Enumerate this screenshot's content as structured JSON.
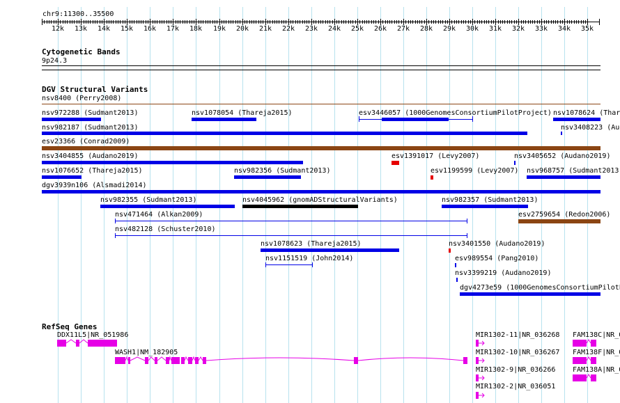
{
  "ruler": {
    "position_label": "chr9:11300..35500",
    "ticks": [
      "12k",
      "13k",
      "14k",
      "15k",
      "16k",
      "17k",
      "18k",
      "19k",
      "20k",
      "21k",
      "22k",
      "23k",
      "24k",
      "25k",
      "26k",
      "27k",
      "28k",
      "29k",
      "30k",
      "31k",
      "32k",
      "33k",
      "34k",
      "35k"
    ]
  },
  "colors": {
    "grid": "#b7e2ee",
    "dgv_loss": "#0000e6",
    "dgv_inversion": "#8b4513",
    "dgv_gain": "#e60000",
    "dgv_complex": "#000000",
    "refseq": "#e600e6",
    "dgv_top_line": "#8b4513"
  },
  "tracks": {
    "cytoband": {
      "title": "Cytogenetic Bands",
      "band": "9p24.3"
    },
    "dgv": {
      "title": "DGV Structural Variants",
      "features": [
        "nsv8400 (Perry2008)",
        "nsv972288 (Sudmant2013)",
        "nsv1078054 (Thareja2015)",
        "esv3446057 (1000GenomesConsortiumPilotProject)",
        "nsv1078624 (Thar",
        "nsv982187 (Sudmant2013)",
        "nsv3408223 (Aud",
        "esv23366 (Conrad2009)",
        "nsv3404855 (Audano2019)",
        "esv1391017 (Levy2007)",
        "nsv3405652 (Audano2019)",
        "nsv1076652 (Thareja2015)",
        "nsv982356 (Sudmant2013)",
        "esv1199599 (Levy2007)",
        "nsv968757 (Sudmant2013)",
        "dgv3939n106 (Alsmadi2014)",
        "nsv982355 (Sudmant2013)",
        "nsv4045962 (gnomADStructuralVariants)",
        "nsv982357 (Sudmant2013)",
        "nsv471464 (Alkan2009)",
        "esv2759654 (Redon2006)",
        "nsv482128 (Schuster2010)",
        "nsv1078623 (Thareja2015)",
        "nsv3401550 (Audano2019)",
        "nsv1151519 (John2014)",
        "esv989554 (Pang2010)",
        "nsv3399219 (Audano2019)",
        "dgv4273e59 (1000GenomesConsortiumPilotP"
      ]
    },
    "refseq": {
      "title": "RefSeq Genes",
      "genes": [
        "DDX11L5|NR_051986",
        "WASH1|NM_182905",
        "MIR1302-11|NR_036268",
        "MIR1302-10|NR_036267",
        "MIR1302-9|NR_036266",
        "MIR1302-2|NR_036051",
        "FAM138C|NR_0",
        "FAM138F|NR_0",
        "FAM138A|NR_0"
      ]
    }
  }
}
